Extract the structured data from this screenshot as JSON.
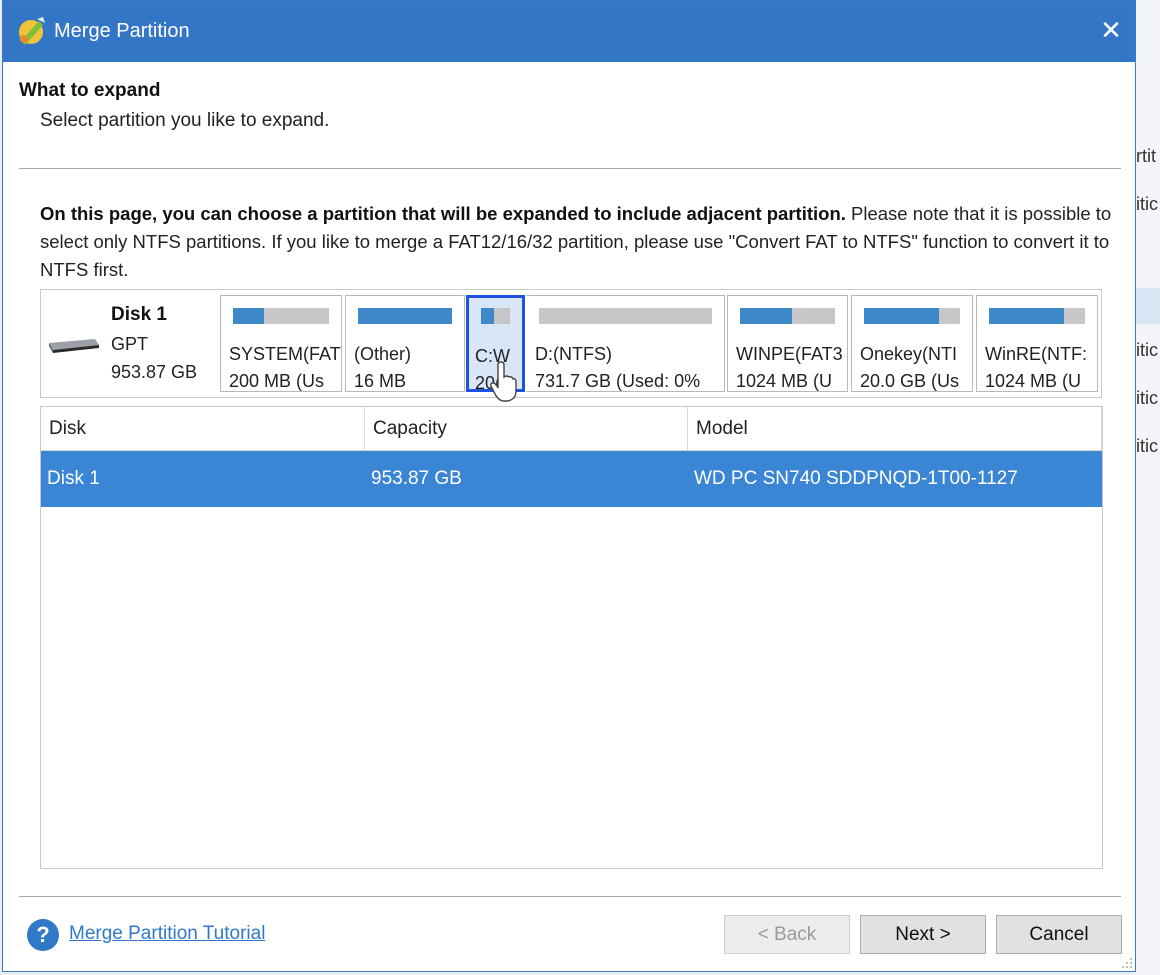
{
  "background_app": {
    "fragments": [
      "rtit",
      "itic",
      "itic",
      "itic",
      "itic"
    ]
  },
  "window": {
    "title": "Merge Partition",
    "close_label": "✕"
  },
  "header": {
    "title": "What to expand",
    "subtitle": "Select partition you like to expand."
  },
  "description": {
    "bold": "On this page, you can choose a partition that will be expanded to include adjacent partition.",
    "normal": " Please note that it is possible to select only NTFS partitions. If you like to merge a FAT12/16/32 partition, please use \"Convert FAT to NTFS\" function to convert it to NTFS first."
  },
  "disk_map": {
    "disk_name": "Disk 1",
    "disk_type": "GPT",
    "disk_size": "953.87 GB",
    "partitions": [
      {
        "name": "SYSTEM(FAT",
        "info": "200 MB (Us",
        "used_fraction": 0.32,
        "selected": false
      },
      {
        "name": "(Other)",
        "info": "16 MB",
        "used_fraction": 1.0,
        "selected": false
      },
      {
        "name": "C:W",
        "info": "20(",
        "used_fraction": 0.45,
        "selected": true
      },
      {
        "name": "D:(NTFS)",
        "info": "731.7 GB (Used: 0%",
        "used_fraction": 0.0,
        "selected": false
      },
      {
        "name": "WINPE(FAT3",
        "info": "1024 MB (U",
        "used_fraction": 0.55,
        "selected": false
      },
      {
        "name": "Onekey(NTI",
        "info": "20.0 GB (Us",
        "used_fraction": 0.78,
        "selected": false
      },
      {
        "name": "WinRE(NTF:",
        "info": "1024 MB (U",
        "used_fraction": 0.78,
        "selected": false
      }
    ]
  },
  "table": {
    "headers": [
      "Disk",
      "Capacity",
      "Model"
    ],
    "rows": [
      {
        "disk": "Disk 1",
        "capacity": "953.87 GB",
        "model": "WD PC SN740 SDDPNQD-1T00-1127",
        "selected": true
      }
    ]
  },
  "footer": {
    "help_icon": "question-icon",
    "help_link": "Merge Partition Tutorial",
    "back_label": "< Back",
    "next_label": "Next >",
    "cancel_label": "Cancel"
  },
  "colors": {
    "titlebar": "#3476c6",
    "selection": "#3a86d4",
    "partition_used": "#3f88c9",
    "selected_partition_border": "#1f52e0"
  }
}
